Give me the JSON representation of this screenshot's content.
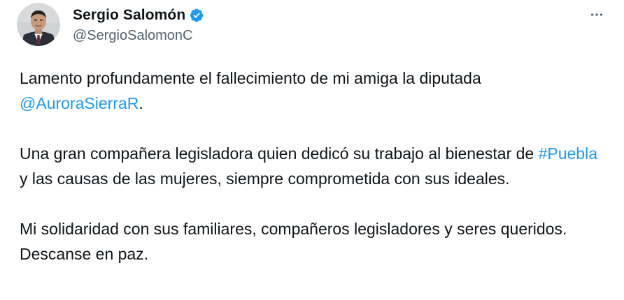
{
  "author": {
    "display_name": "Sergio Salomón",
    "handle": "@SergioSalomonC",
    "verified": true,
    "avatar_icon": "profile-photo"
  },
  "menu": {
    "more_icon": "more-horizontal-icon"
  },
  "colors": {
    "link": "#1d9bf0",
    "verified_badge": "#1d9bf0",
    "secondary_text": "#536471",
    "primary_text": "#0f1419"
  },
  "tweet": {
    "p1_text": "Lamento profundamente el fallecimiento de mi amiga la diputada",
    "p1_mention": "@AuroraSierraR",
    "p1_end": ".",
    "p2_text_a": "Una gran compañera legisladora quien dedicó su trabajo al bienestar de",
    "p2_hashtag": "#Puebla",
    "p2_text_b": " y las causas de las mujeres, siempre comprometida con sus ideales.",
    "p3_text": "Mi solidaridad con sus familiares, compañeros legisladores y seres queridos. Descanse en paz."
  }
}
